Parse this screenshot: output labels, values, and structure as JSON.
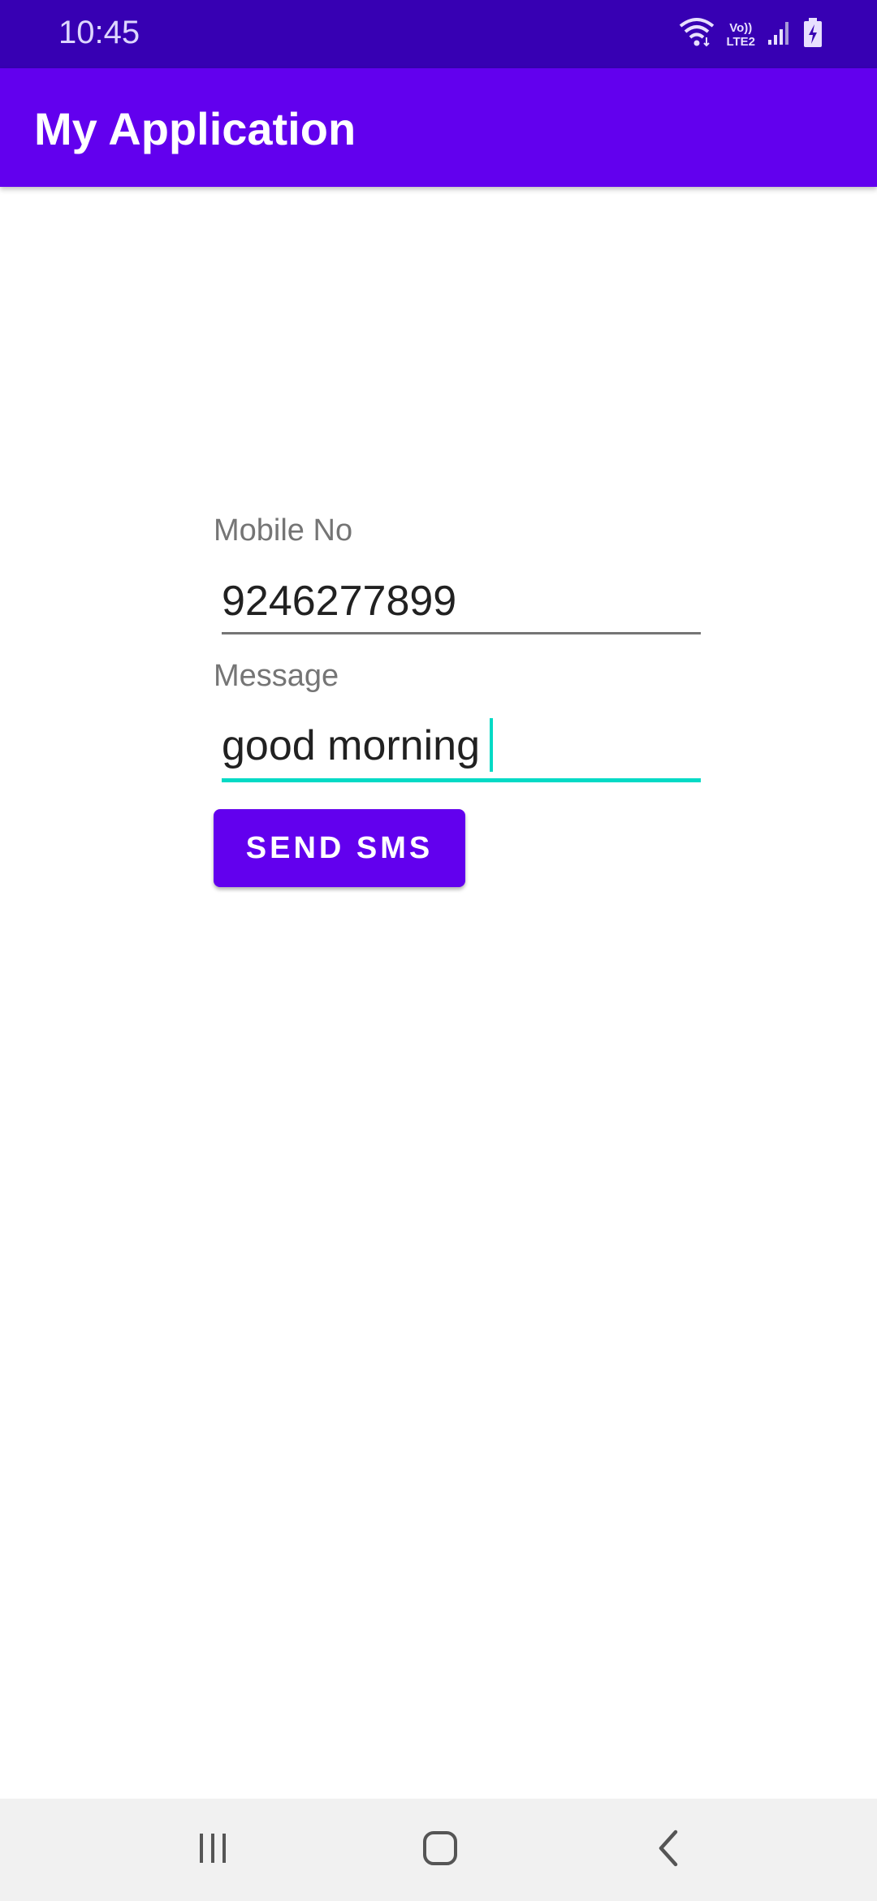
{
  "status_bar": {
    "time": "10:45",
    "icons": [
      "wifi-icon",
      "volte-lte2-icon",
      "signal-icon",
      "battery-charging-icon"
    ],
    "lte_top": "Vo))",
    "lte_bottom": "LTE2"
  },
  "app_bar": {
    "title": "My Application",
    "color": "#6200ee",
    "status_color": "#3700b3"
  },
  "form": {
    "mobile_label": "Mobile No",
    "mobile_value": "9246277899",
    "message_label": "Message",
    "message_value": "good morning",
    "accent_color": "#03dac5"
  },
  "send_button": {
    "label": "SEND SMS"
  },
  "nav_bar": {
    "icons": [
      "recents-icon",
      "home-icon",
      "back-icon"
    ]
  }
}
